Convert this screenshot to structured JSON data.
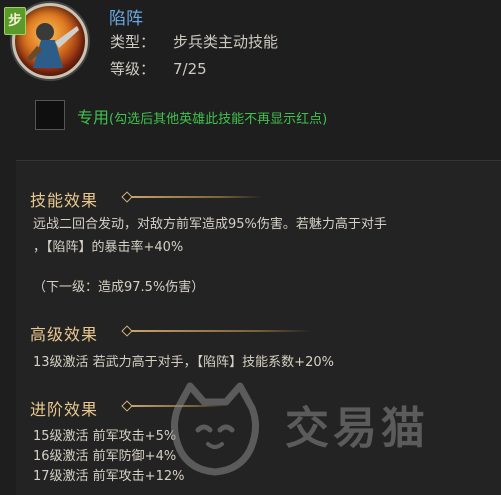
{
  "skill": {
    "tag": "步",
    "name": "陷阵",
    "type_label": "类型：",
    "type_value": "步兵类主动技能",
    "level_label": "等级：",
    "level_value": "7/25",
    "icon": "soldier-portrait-icon"
  },
  "exclusive": {
    "label": "专用",
    "note": "(勾选后其他英雄此技能不再显示红点)",
    "checked": false
  },
  "effect": {
    "title": "技能效果",
    "line1": "远战二回合发动，对敌方前军造成95%伤害。若魅力高于对手",
    "line2": "，【陷阵】的暴击率+40%",
    "next_level": "（下一级：造成97.5%伤害）"
  },
  "advanced": {
    "title": "高级效果",
    "line1": "13级激活 若武力高于对手，【陷阵】技能系数+20%"
  },
  "promotion": {
    "title": "进阶效果",
    "lines": [
      "15级激活 前军攻击+5%",
      "16级激活 前军防御+4%",
      "17级激活 前军攻击+12%"
    ]
  },
  "watermark": {
    "text": "交易猫",
    "icon": "cat-logo-icon"
  },
  "colors": {
    "name_blue": "#6aa8e0",
    "title_gold": "#e8c890",
    "green": "#3fc24d",
    "tag_green": "#5a9a2a"
  }
}
